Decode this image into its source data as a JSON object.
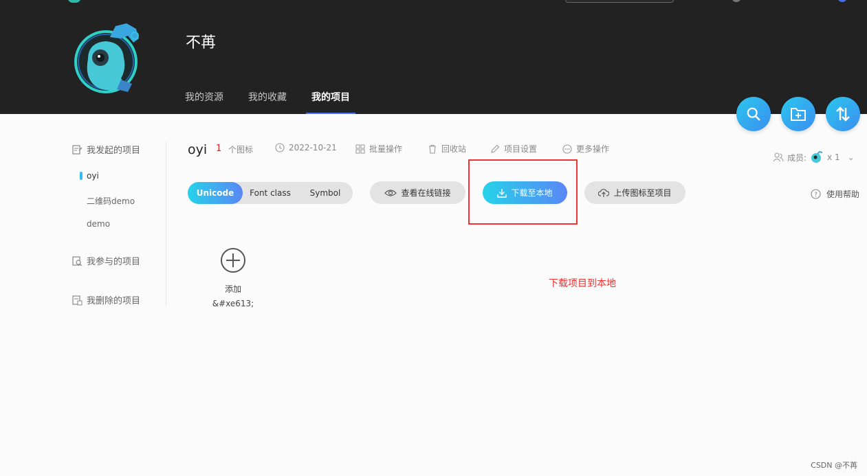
{
  "user": {
    "name": "不苒"
  },
  "nav": {
    "tabs": [
      {
        "label": "我的资源"
      },
      {
        "label": "我的收藏"
      },
      {
        "label": "我的项目"
      }
    ]
  },
  "sidebar": {
    "groups": [
      {
        "label": "我发起的项目"
      },
      {
        "label": "我参与的项目"
      },
      {
        "label": "我删除的项目"
      }
    ],
    "projects": [
      {
        "label": "oyi"
      },
      {
        "label": "二维码demo"
      },
      {
        "label": "demo"
      }
    ]
  },
  "project": {
    "name": "oyi",
    "icon_count": "1",
    "icon_count_label": "个图标",
    "date": "2022-10-21",
    "batch": "批量操作",
    "recycle": "回收站",
    "settings": "项目设置",
    "more": "更多操作"
  },
  "members": {
    "label": "成员:",
    "count": "x 1"
  },
  "toggles": [
    {
      "label": "Unicode"
    },
    {
      "label": "Font class"
    },
    {
      "label": "Symbol"
    }
  ],
  "actions": {
    "view_link": "查看在线链接",
    "download": "下载至本地",
    "upload": "上传图标至项目"
  },
  "help": "使用帮助",
  "add_card": {
    "label": "添加",
    "code": "&#xe613;"
  },
  "annotation": "下载项目到本地",
  "watermark": "CSDN @不苒",
  "colors": {
    "accent": "#35b9f0",
    "gradient_start": "#26d3e9",
    "gradient_end": "#5a86f6",
    "highlight": "#ee3333"
  }
}
